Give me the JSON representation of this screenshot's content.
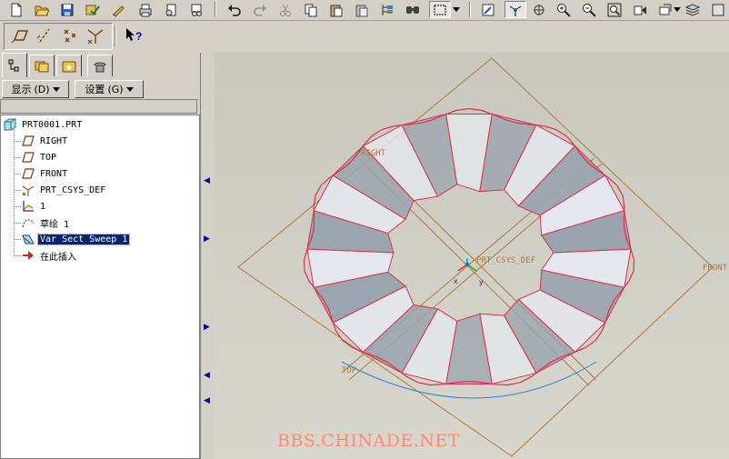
{
  "toolbar": {
    "icons": [
      "new-icon",
      "open-icon",
      "save-icon",
      "save-as-icon",
      "regenerate-icon",
      "print-icon",
      "send-mail-icon",
      "close-window-icon",
      "undo-icon",
      "redo-icon",
      "cut-icon",
      "copy-icon",
      "paste-icon",
      "paste-special-icon",
      "model-tree-icon",
      "search-icon",
      "select-box-icon",
      "repaint-icon",
      "spin-center-icon",
      "orient-icon",
      "zoom-in-icon",
      "zoom-out-icon",
      "refit-icon",
      "view-manager-icon",
      "saved-views-icon",
      "layers-icon"
    ]
  },
  "datum_toolbar": {
    "icons": [
      "datum-plane-display-icon",
      "datum-axis-display-icon",
      "point-display-icon",
      "csys-display-icon",
      "context-help-icon"
    ]
  },
  "navigator_tabs": [
    "model-tree-tab",
    "folder-browser-tab",
    "favorites-tab",
    "connections-tab"
  ],
  "model_tree": {
    "show_menu": "显示",
    "show_accel": "(D)",
    "settings_menu": "设置",
    "settings_accel": "(G)",
    "items": [
      {
        "label": "PRT0001.PRT",
        "icon": "part-icon"
      },
      {
        "label": "RIGHT",
        "icon": "datum-plane-icon"
      },
      {
        "label": "TOP",
        "icon": "datum-plane-icon"
      },
      {
        "label": "FRONT",
        "icon": "datum-plane-icon"
      },
      {
        "label": "PRT_CSYS_DEF",
        "icon": "csys-icon"
      },
      {
        "label": "1",
        "icon": "graph-icon"
      },
      {
        "label": "草绘 1",
        "icon": "sketch-icon"
      },
      {
        "label": "Var Sect Sweep 1",
        "icon": "var-sect-sweep-icon",
        "selected": true
      },
      {
        "label": "在此插入",
        "icon": "insert-here-arrow-icon"
      }
    ]
  },
  "graphics": {
    "datum_labels": {
      "right": "RIGHT",
      "front": "FRONT",
      "top": "TOP",
      "csys": "PRT_CSYS_DEF",
      "axis_x": "x",
      "axis_y": "y"
    },
    "colors": {
      "edge": "#e0304a",
      "face_light": "#e4e8ee",
      "face_dark": "#9aa4ae",
      "datum": "#b07838",
      "background": "#cbcac0",
      "selection": "#0a246a"
    }
  },
  "watermark": "BBS.CHINADE.NET"
}
